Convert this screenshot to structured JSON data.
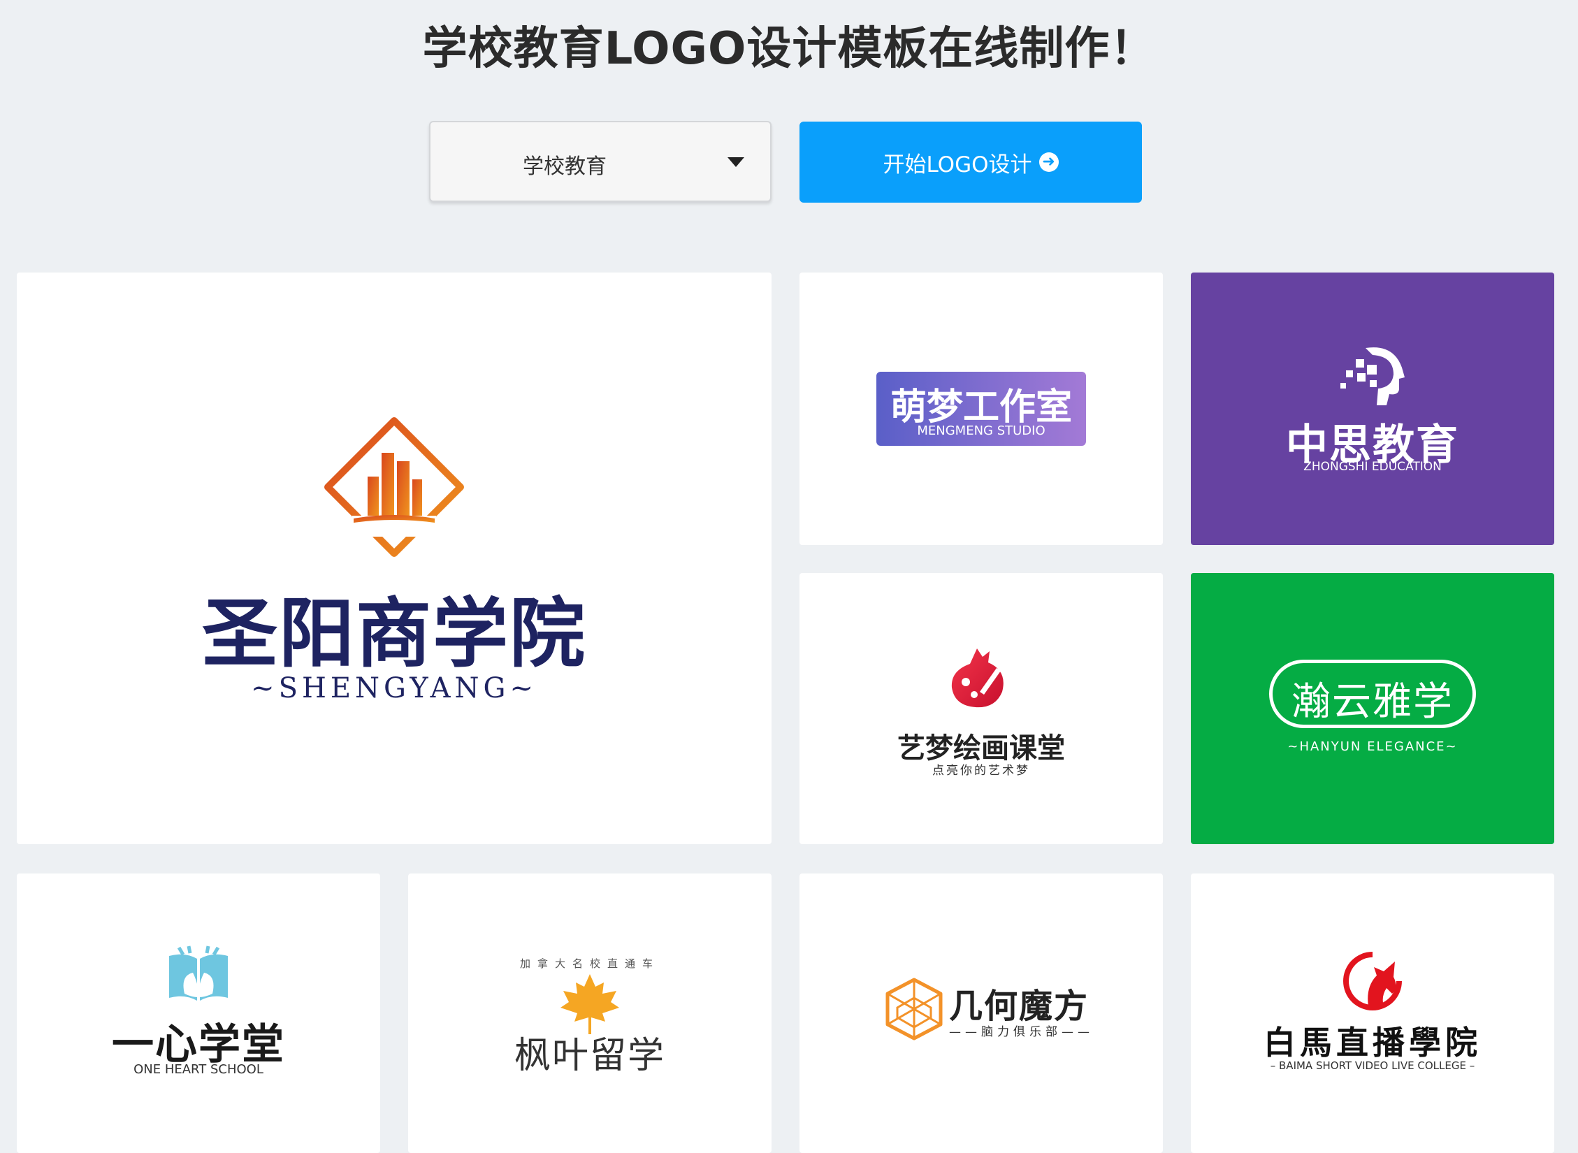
{
  "header": {
    "title": "学校教育LOGO设计模板在线制作！"
  },
  "controls": {
    "category_select": {
      "value": "学校教育"
    },
    "start_button": {
      "label": "开始LOGO设计"
    }
  },
  "colors": {
    "primary": "#0a9ffb",
    "background": "#edf0f3",
    "purple_card": "#6642a1",
    "green_card": "#05ac44"
  },
  "templates": [
    {
      "name": "圣阳商学院",
      "subtitle": "SHENGYANG",
      "icon": "building-diamond-icon"
    },
    {
      "name": "萌梦工作室",
      "subtitle": "MENGMENG STUDIO"
    },
    {
      "name": "中思教育",
      "subtitle": "ZHONGSHI EDUCATION",
      "icon": "head-pixel-icon"
    },
    {
      "name": "艺梦绘画课堂",
      "subtitle": "点亮你的艺术梦",
      "icon": "palette-brush-icon"
    },
    {
      "name": "瀚云雅学",
      "subtitle": "HANYUN ELEGANCE"
    },
    {
      "name": "一心学堂",
      "subtitle": "ONE HEART SCHOOL",
      "icon": "book-hands-icon"
    },
    {
      "name": "枫叶留学",
      "subtitle": "加拿大名校直通车",
      "icon": "maple-leaf-icon"
    },
    {
      "name": "几何魔方",
      "subtitle": "脑力俱乐部",
      "icon": "geometric-cube-icon"
    },
    {
      "name": "白馬直播學院",
      "subtitle": "BAIMA SHORT VIDEO LIVE COLLEGE",
      "icon": "horse-head-icon"
    }
  ]
}
